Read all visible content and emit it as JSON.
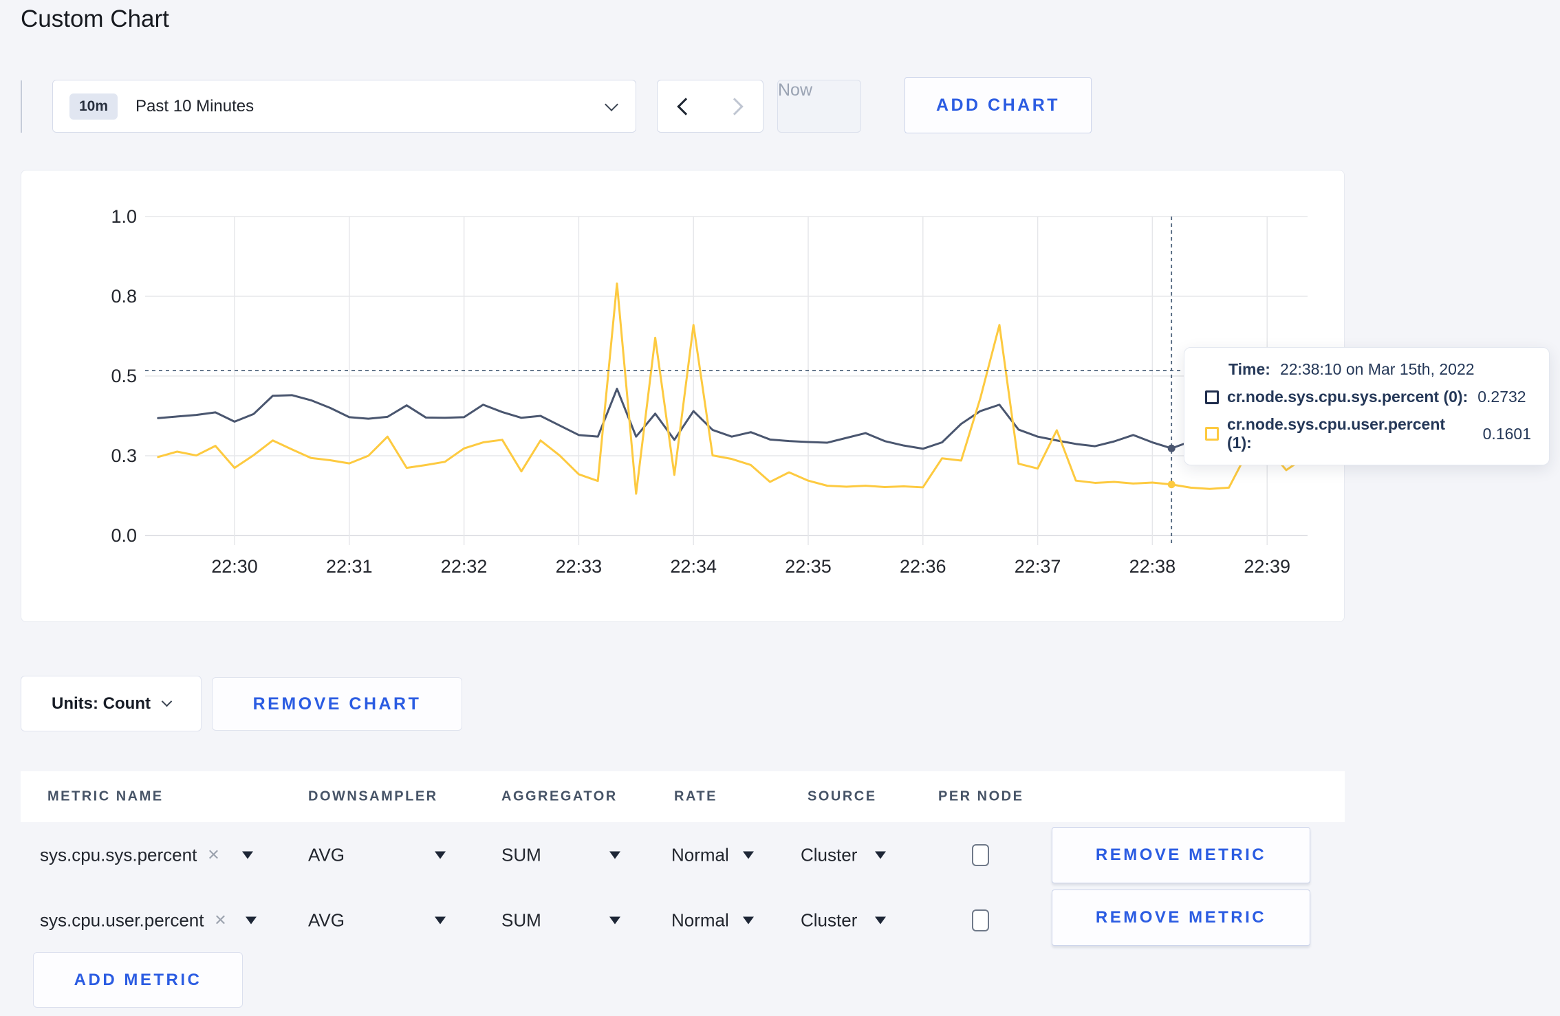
{
  "page": {
    "title": "Custom Chart",
    "background": "#f4f5f9",
    "accent_blue": "#2b5ce2"
  },
  "toolbar": {
    "time_range": {
      "badge": "10m",
      "label": "Past 10 Minutes"
    },
    "now_label": "Now",
    "add_chart_label": "ADD CHART"
  },
  "icons": {
    "close": "×"
  },
  "tooltip": {
    "time_label": "Time:",
    "time_value": "22:38:10 on Mar 15th, 2022",
    "series": [
      {
        "label": "cr.node.sys.cpu.sys.percent (0):",
        "value": "0.2732",
        "color": "#1f2d4d"
      },
      {
        "label": "cr.node.sys.cpu.user.percent (1):",
        "value": "0.1601",
        "color": "#fdca40"
      }
    ]
  },
  "footer": {
    "units_label": "Units: Count",
    "remove_chart_label": "REMOVE CHART"
  },
  "table": {
    "headers": [
      "METRIC NAME",
      "DOWNSAMPLER",
      "AGGREGATOR",
      "RATE",
      "SOURCE",
      "PER NODE"
    ],
    "rows": [
      {
        "metric": "sys.cpu.sys.percent",
        "downsampler": "AVG",
        "aggregator": "SUM",
        "rate": "Normal",
        "source": "Cluster",
        "per_node_checked": false,
        "remove_label": "REMOVE METRIC"
      },
      {
        "metric": "sys.cpu.user.percent",
        "downsampler": "AVG",
        "aggregator": "SUM",
        "rate": "Normal",
        "source": "Cluster",
        "per_node_checked": false,
        "remove_label": "REMOVE METRIC"
      }
    ],
    "add_metric_label": "ADD METRIC"
  },
  "chart_data": {
    "type": "line",
    "title": "",
    "xlabel": "",
    "ylabel": "",
    "ylim": [
      0,
      1
    ],
    "grid": true,
    "legend_position": "tooltip-only",
    "x_start": "22:29:20",
    "x_step_seconds": 10,
    "x_ticks": [
      "22:30",
      "22:31",
      "22:32",
      "22:33",
      "22:34",
      "22:35",
      "22:36",
      "22:37",
      "22:38",
      "22:39"
    ],
    "y_ticks": [
      {
        "label": "1.0",
        "value": 1.0
      },
      {
        "label": "0.8",
        "value": 0.75
      },
      {
        "label": "0.5",
        "value": 0.5
      },
      {
        "label": "0.3",
        "value": 0.25
      },
      {
        "label": "0.0",
        "value": 0.0
      }
    ],
    "series": [
      {
        "name": "cr.node.sys.cpu.sys.percent (0)",
        "color": "#4a566f",
        "values": [
          0.368,
          0.373,
          0.378,
          0.386,
          0.357,
          0.381,
          0.438,
          0.44,
          0.424,
          0.4,
          0.371,
          0.366,
          0.372,
          0.408,
          0.37,
          0.369,
          0.371,
          0.41,
          0.387,
          0.369,
          0.375,
          0.345,
          0.315,
          0.31,
          0.46,
          0.31,
          0.382,
          0.3,
          0.39,
          0.331,
          0.31,
          0.324,
          0.301,
          0.296,
          0.293,
          0.291,
          0.306,
          0.321,
          0.296,
          0.282,
          0.272,
          0.292,
          0.35,
          0.39,
          0.41,
          0.332,
          0.31,
          0.298,
          0.287,
          0.28,
          0.295,
          0.315,
          0.292,
          0.2732,
          0.295,
          0.301,
          0.296,
          0.299,
          0.304,
          0.299,
          0.302
        ]
      },
      {
        "name": "cr.node.sys.cpu.user.percent (1)",
        "color": "#fdca40",
        "values": [
          0.246,
          0.263,
          0.251,
          0.281,
          0.212,
          0.252,
          0.298,
          0.27,
          0.243,
          0.236,
          0.226,
          0.25,
          0.31,
          0.212,
          0.221,
          0.231,
          0.273,
          0.292,
          0.3,
          0.201,
          0.298,
          0.251,
          0.192,
          0.171,
          0.79,
          0.131,
          0.62,
          0.19,
          0.66,
          0.251,
          0.24,
          0.221,
          0.168,
          0.198,
          0.172,
          0.156,
          0.153,
          0.156,
          0.152,
          0.154,
          0.151,
          0.242,
          0.235,
          0.43,
          0.66,
          0.225,
          0.21,
          0.33,
          0.172,
          0.165,
          0.168,
          0.163,
          0.166,
          0.1601,
          0.15,
          0.146,
          0.15,
          0.265,
          0.276,
          0.205,
          0.246
        ]
      }
    ],
    "crosshair": {
      "time": "22:38:10",
      "x_index": 53,
      "y_fraction": 0.517
    },
    "colors": {
      "grid": "#e6e7ea",
      "axis_text": "#24272e",
      "crosshair": "#4e637c"
    }
  }
}
